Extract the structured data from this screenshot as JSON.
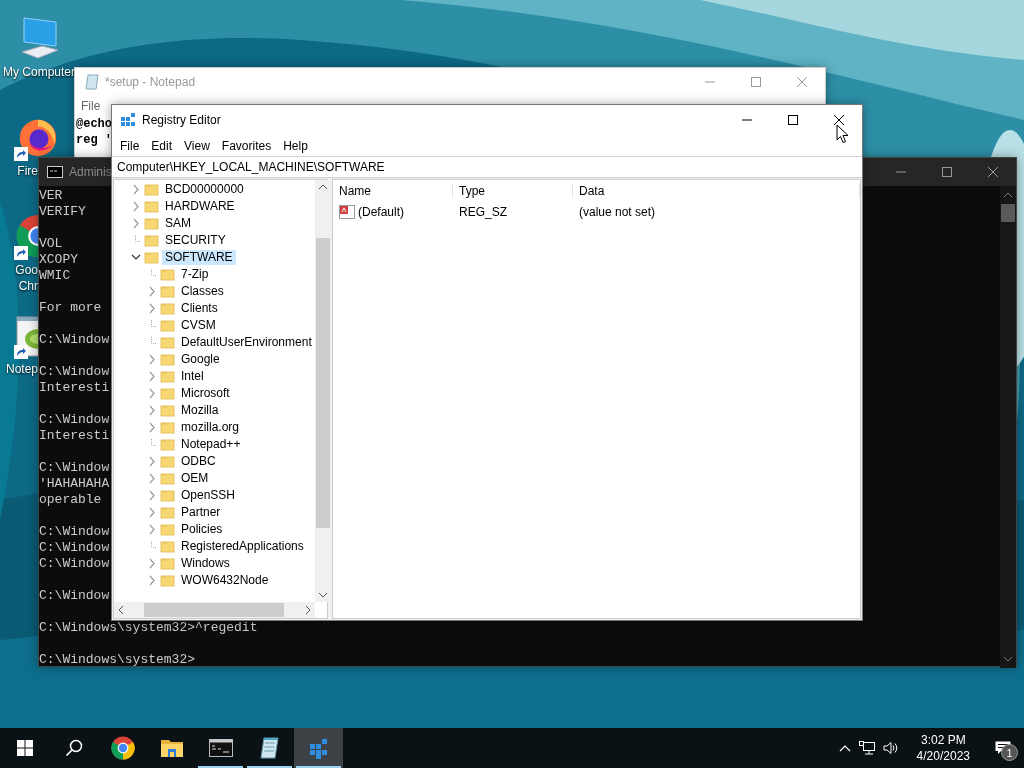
{
  "desktop": {
    "icons": [
      {
        "kind": "computer",
        "shortcut": false,
        "label_lines": [
          "My Computer"
        ]
      },
      {
        "kind": "firefox",
        "shortcut": true,
        "label_lines": [
          "Fire"
        ]
      },
      {
        "kind": "chrome",
        "shortcut": true,
        "label_lines": [
          "Goo",
          "Chr"
        ]
      },
      {
        "kind": "notepad",
        "shortcut": true,
        "label_lines": [
          "Notep"
        ]
      }
    ]
  },
  "notepad": {
    "title": "*setup - Notepad",
    "menu": [
      "File"
    ],
    "lines": [
      "@echo",
      "reg '"
    ]
  },
  "console": {
    "title": "Adminis",
    "blocks": [
      [
        "VER",
        "VERIFY"
      ],
      [
        "VOL",
        "XCOPY",
        "WMIC"
      ],
      [
        "For more"
      ],
      [
        "C:\\Window"
      ],
      [
        "C:\\Window",
        "Interesti"
      ],
      [
        "C:\\Window",
        "Interesti"
      ],
      [
        "C:\\Window",
        "'HAHAHAHA",
        "operable"
      ],
      [
        "C:\\Window",
        "C:\\Window",
        "C:\\Window"
      ],
      [
        "C:\\Window"
      ],
      [
        "C:\\Windows\\system32>^regedit"
      ],
      [
        "C:\\Windows\\system32>"
      ]
    ]
  },
  "registry_editor": {
    "title": "Registry Editor",
    "menu": [
      "File",
      "Edit",
      "View",
      "Favorites",
      "Help"
    ],
    "address": "Computer\\HKEY_LOCAL_MACHINE\\SOFTWARE",
    "tree": [
      {
        "label": "BCD00000000",
        "expanded": false,
        "selected": false
      },
      {
        "label": "HARDWARE",
        "expanded": false,
        "selected": false
      },
      {
        "label": "SAM",
        "expanded": false,
        "selected": false
      },
      {
        "label": "SECURITY",
        "selected": false
      },
      {
        "label": "SOFTWARE",
        "expanded": true,
        "selected": true,
        "children": [
          {
            "label": "7-Zip",
            "selected": false
          },
          {
            "label": "Classes",
            "expanded": false,
            "selected": false
          },
          {
            "label": "Clients",
            "expanded": false,
            "selected": false
          },
          {
            "label": "CVSM",
            "selected": false
          },
          {
            "label": "DefaultUserEnvironment",
            "selected": false
          },
          {
            "label": "Google",
            "expanded": false,
            "selected": false
          },
          {
            "label": "Intel",
            "expanded": false,
            "selected": false
          },
          {
            "label": "Microsoft",
            "expanded": false,
            "selected": false
          },
          {
            "label": "Mozilla",
            "expanded": false,
            "selected": false
          },
          {
            "label": "mozilla.org",
            "expanded": false,
            "selected": false
          },
          {
            "label": "Notepad++",
            "selected": false
          },
          {
            "label": "ODBC",
            "expanded": false,
            "selected": false
          },
          {
            "label": "OEM",
            "expanded": false,
            "selected": false
          },
          {
            "label": "OpenSSH",
            "expanded": false,
            "selected": false
          },
          {
            "label": "Partner",
            "expanded": false,
            "selected": false
          },
          {
            "label": "Policies",
            "expanded": false,
            "selected": false
          },
          {
            "label": "RegisteredApplications",
            "selected": false
          },
          {
            "label": "Windows",
            "expanded": false,
            "selected": false
          },
          {
            "label": "WOW6432Node",
            "expanded": false,
            "selected": false
          }
        ]
      }
    ],
    "columns": [
      "Name",
      "Type",
      "Data"
    ],
    "values": [
      {
        "name": "(Default)",
        "type": "REG_SZ",
        "data": "(value not set)"
      }
    ]
  },
  "taskbar": {
    "buttons": [
      {
        "kind": "start",
        "running": false,
        "active": false
      },
      {
        "kind": "search",
        "running": false,
        "active": false
      },
      {
        "kind": "chrome",
        "running": false,
        "active": false
      },
      {
        "kind": "explorer",
        "running": false,
        "active": false
      },
      {
        "kind": "console",
        "running": true,
        "active": false
      },
      {
        "kind": "notepad",
        "running": true,
        "active": false
      },
      {
        "kind": "regedit",
        "running": true,
        "active": true
      }
    ],
    "time": "3:02 PM",
    "date": "4/20/2023",
    "notification_count": "1"
  }
}
